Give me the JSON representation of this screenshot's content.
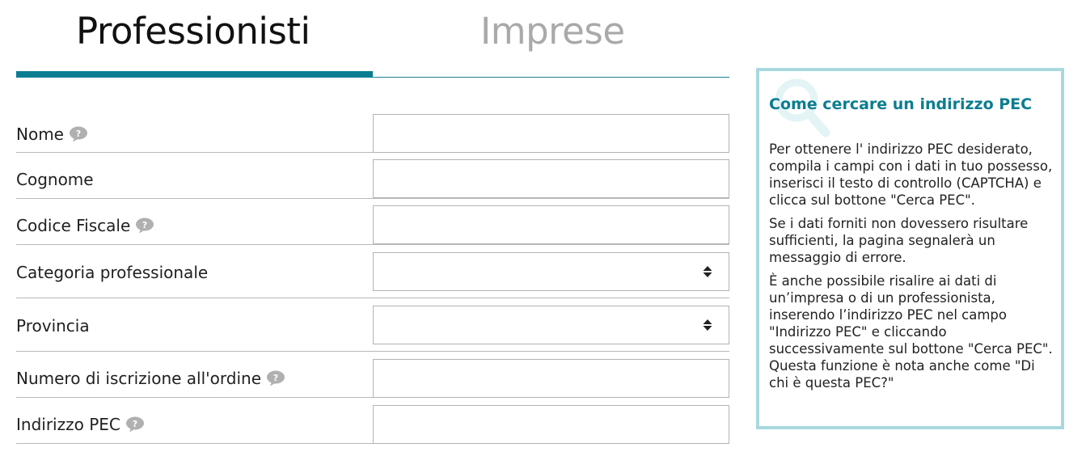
{
  "tabs": [
    {
      "label": "Professionisti",
      "active": true
    },
    {
      "label": "Imprese",
      "active": false
    }
  ],
  "form": {
    "fields": [
      {
        "label": "Nome",
        "type": "text",
        "value": "",
        "has_help": true
      },
      {
        "label": "Cognome",
        "type": "text",
        "value": "",
        "has_help": false
      },
      {
        "label": "Codice Fiscale",
        "type": "text",
        "value": "",
        "has_help": true
      },
      {
        "label": "Categoria professionale",
        "type": "select",
        "value": "",
        "has_help": false
      },
      {
        "label": "Provincia",
        "type": "select",
        "value": "",
        "has_help": false
      },
      {
        "label": "Numero di iscrizione all'ordine",
        "type": "text",
        "value": "",
        "has_help": true
      },
      {
        "label": "Indirizzo PEC",
        "type": "text",
        "value": "",
        "has_help": true
      }
    ]
  },
  "info": {
    "title": "Come cercare un indirizzo PEC",
    "paragraphs": [
      "Per ottenere l' indirizzo PEC desiderato, compila i campi con i dati in tuo possesso, inserisci il testo di controllo (CAPTCHA) e clicca sul bottone \"Cerca PEC\".",
      "Se i dati forniti non dovessero risultare sufficienti, la pagina segnalerà un messaggio di errore.",
      "È anche possibile risalire ai dati di un’impresa o di un professionista, inserendo l’indirizzo PEC nel campo \"Indirizzo PEC\" e cliccando successivamente  sul bottone \"Cerca PEC\". Questa funzione è nota anche come \"Di chi è questa PEC?\""
    ]
  },
  "icons": {
    "help": "speech-bubble-help-icon",
    "select": "sort-arrows-icon",
    "info": "magnifier-icon"
  },
  "colors": {
    "accent": "#0b7d91",
    "info_border": "#a9d8df",
    "tab_inactive": "#a9a9a9",
    "help_icon": "#b0b0b0"
  }
}
